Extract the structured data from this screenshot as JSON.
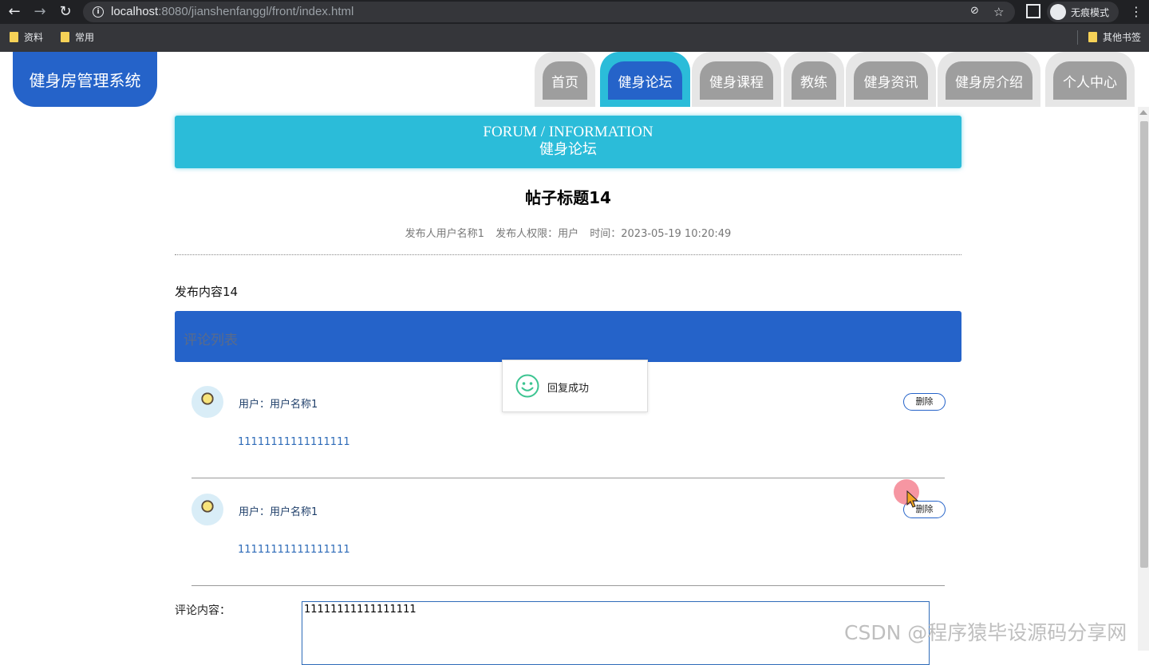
{
  "browser": {
    "url_host": "localhost",
    "url_rest": ":8080/jianshenfanggl/front/index.html",
    "incognito_label": "无痕模式",
    "bookmarks": [
      "资料",
      "常用"
    ],
    "other_bookmarks": "其他书签"
  },
  "site": {
    "logo": "健身房管理系统",
    "nav": [
      "首页",
      "健身论坛",
      "健身课程",
      "教练",
      "健身资讯",
      "健身房介绍",
      "个人中心"
    ],
    "active_nav": "健身论坛"
  },
  "banner": {
    "en": "FORUM / INFORMATION",
    "cn": "健身论坛"
  },
  "post": {
    "title": "帖子标题14",
    "author": "发布人用户名称1",
    "role": "发布人权限：用户",
    "time": "时间：2023-05-19 10:20:49",
    "content": "发布内容14"
  },
  "comments": {
    "header": "评论列表",
    "items": [
      {
        "user": "用户：用户名称1",
        "text": "11111111111111111",
        "delete_label": "删除"
      },
      {
        "user": "用户：用户名称1",
        "text": "11111111111111111",
        "delete_label": "删除"
      }
    ]
  },
  "toast": {
    "message": "回复成功"
  },
  "form": {
    "label": "评论内容：",
    "value": "11111111111111111"
  },
  "watermark": "CSDN @程序猿毕设源码分享网",
  "colors": {
    "primary": "#2563c9",
    "accent": "#2bbcd9",
    "nav_inactive": "#9e9e9e"
  }
}
